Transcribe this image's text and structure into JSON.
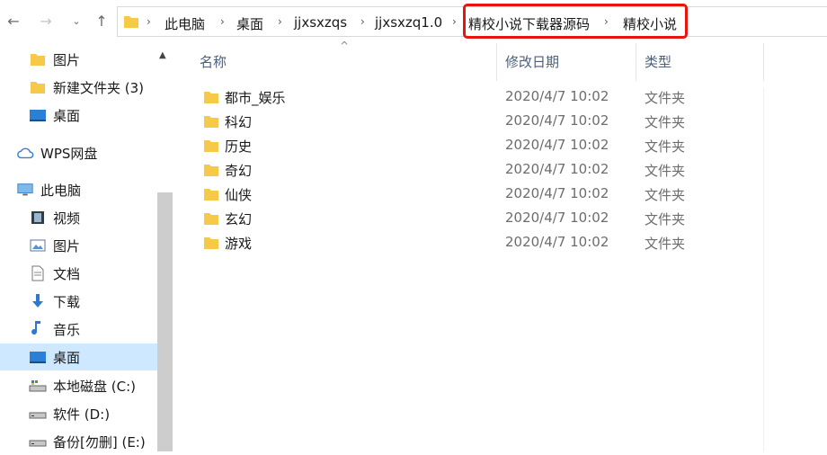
{
  "address_bar": {
    "crumbs": [
      "此电脑",
      "桌面",
      "jjxsxzqs",
      "jjxsxzq1.0",
      "精校小说下载器源码",
      "精校小说"
    ],
    "separator": "›"
  },
  "nav": {
    "back": "←",
    "forward": "→",
    "recent": "⌄",
    "up": "↑"
  },
  "sidebar": {
    "items": [
      {
        "label": "图片",
        "icon": "folder-icon"
      },
      {
        "label": "新建文件夹 (3)",
        "icon": "folder-icon"
      },
      {
        "label": "桌面",
        "icon": "desktop-icon"
      },
      {
        "label": "WPS网盘",
        "icon": "cloud-icon"
      },
      {
        "label": "此电脑",
        "icon": "computer-icon"
      },
      {
        "label": "视频",
        "icon": "video-icon"
      },
      {
        "label": "图片",
        "icon": "pictures-icon"
      },
      {
        "label": "文档",
        "icon": "document-icon"
      },
      {
        "label": "下载",
        "icon": "download-icon"
      },
      {
        "label": "音乐",
        "icon": "music-icon"
      },
      {
        "label": "桌面",
        "icon": "desktop-icon"
      },
      {
        "label": "本地磁盘 (C:)",
        "icon": "drive-icon"
      },
      {
        "label": "软件 (D:)",
        "icon": "drive-icon"
      },
      {
        "label": "备份[勿删] (E:)",
        "icon": "drive-icon"
      }
    ],
    "selected": "桌面"
  },
  "columns": {
    "name": "名称",
    "date": "修改日期",
    "type": "类型"
  },
  "files": [
    {
      "name": "都市_娱乐",
      "date": "2020/4/7 10:02",
      "type": "文件夹"
    },
    {
      "name": "科幻",
      "date": "2020/4/7 10:02",
      "type": "文件夹"
    },
    {
      "name": "历史",
      "date": "2020/4/7 10:02",
      "type": "文件夹"
    },
    {
      "name": "奇幻",
      "date": "2020/4/7 10:02",
      "type": "文件夹"
    },
    {
      "name": "仙侠",
      "date": "2020/4/7 10:02",
      "type": "文件夹"
    },
    {
      "name": "玄幻",
      "date": "2020/4/7 10:02",
      "type": "文件夹"
    },
    {
      "name": "游戏",
      "date": "2020/4/7 10:02",
      "type": "文件夹"
    }
  ],
  "colors": {
    "folder": "#f7c948",
    "selection": "#cde8ff",
    "highlight": "#e8150f",
    "header_text": "#4c607a"
  }
}
